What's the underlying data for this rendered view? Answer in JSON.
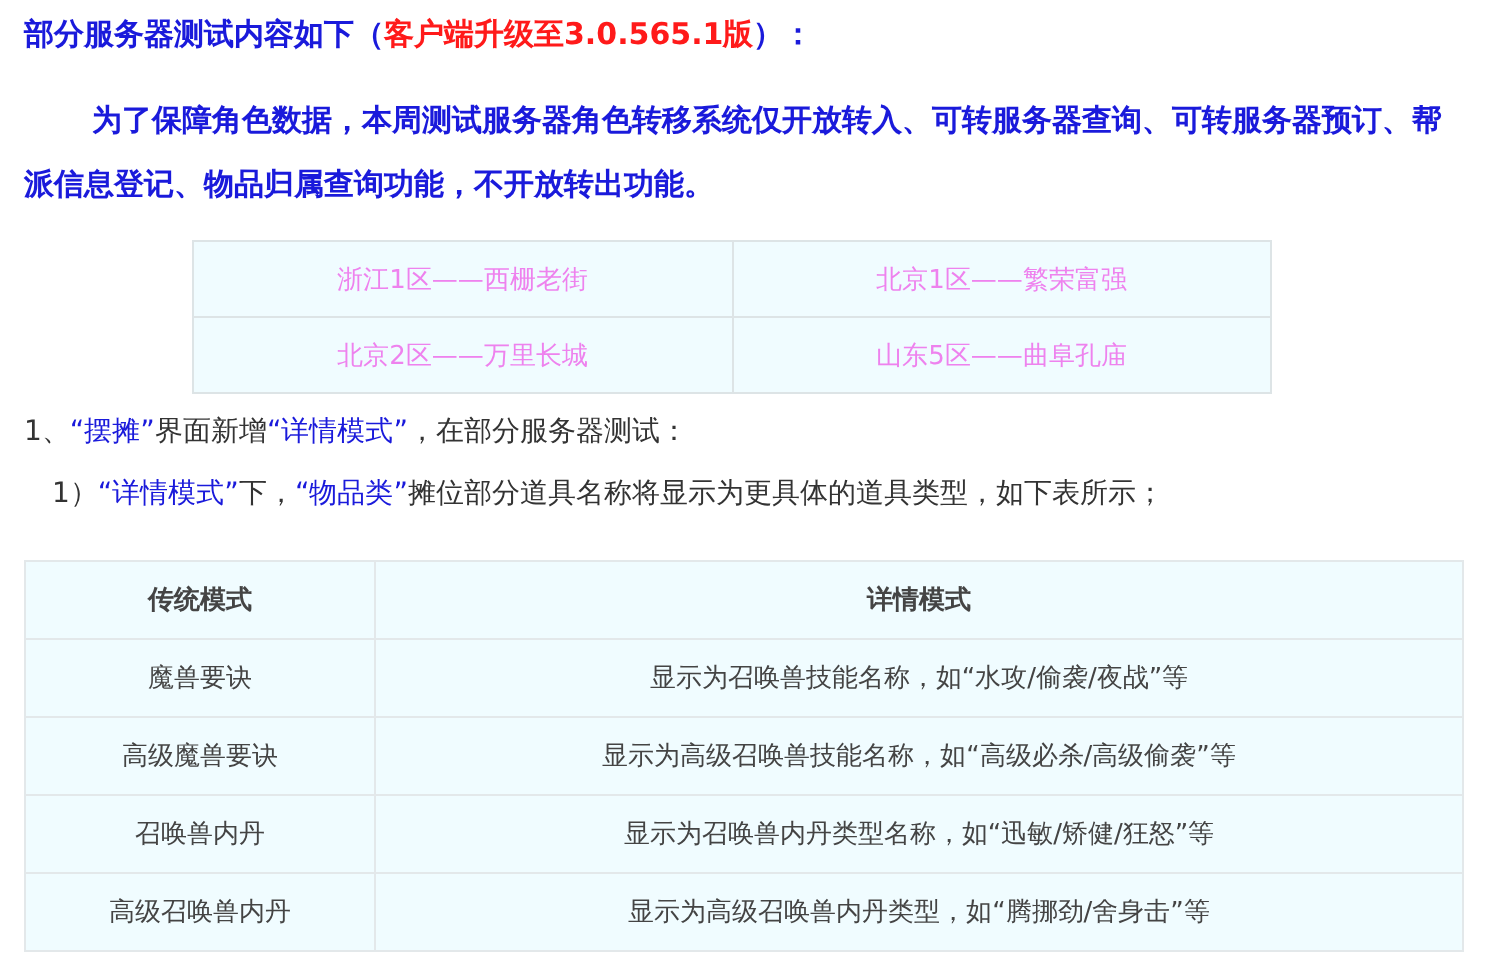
{
  "heading": [
    {
      "kind": "normal",
      "text": "部分服务器测试内容如下（"
    },
    {
      "kind": "accent",
      "text": "客户端升级至3.0.565.1版"
    },
    {
      "kind": "normal",
      "text": "）："
    }
  ],
  "intro": "为了保障角色数据，本周测试服务器角色转移系统仅开放转入、可转服务器查询、可转服务器预订、帮派信息登记、物品归属查询功能，不开放转出功能。",
  "servers": [
    [
      "浙江1区——西栅老街",
      "北京1区——繁荣富强"
    ],
    [
      "北京2区——万里长城",
      "山东5区——曲阜孔庙"
    ]
  ],
  "notes": [
    {
      "kind": "item",
      "parts": [
        {
          "kind": "plain",
          "text": "1、"
        },
        {
          "kind": "quote",
          "text": "“摆摊”"
        },
        {
          "kind": "plain",
          "text": "界面新增"
        },
        {
          "kind": "quote",
          "text": "“详情模式”"
        },
        {
          "kind": "plain",
          "text": "，在部分服务器测试："
        }
      ]
    },
    {
      "kind": "subitem",
      "parts": [
        {
          "kind": "plain",
          "text": "1）"
        },
        {
          "kind": "quote",
          "text": "“详情模式”"
        },
        {
          "kind": "plain",
          "text": "下，"
        },
        {
          "kind": "quote",
          "text": "“物品类”"
        },
        {
          "kind": "plain",
          "text": "摊位部分道具名称将显示为更具体的道具类型，如下表所示；"
        }
      ]
    }
  ],
  "table": {
    "columns": [
      "传统模式",
      "详情模式"
    ],
    "rows": [
      [
        "魔兽要诀",
        "显示为召唤兽技能名称，如“水攻/偷袭/夜战”等"
      ],
      [
        "高级魔兽要诀",
        "显示为高级召唤兽技能名称，如“高级必杀/高级偷袭”等"
      ],
      [
        "召唤兽内丹",
        "显示为召唤兽内丹类型名称，如“迅敏/矫健/狂怒”等"
      ],
      [
        "高级召唤兽内丹",
        "显示为高级召唤兽内丹类型，如“腾挪劲/舍身击”等"
      ]
    ]
  }
}
